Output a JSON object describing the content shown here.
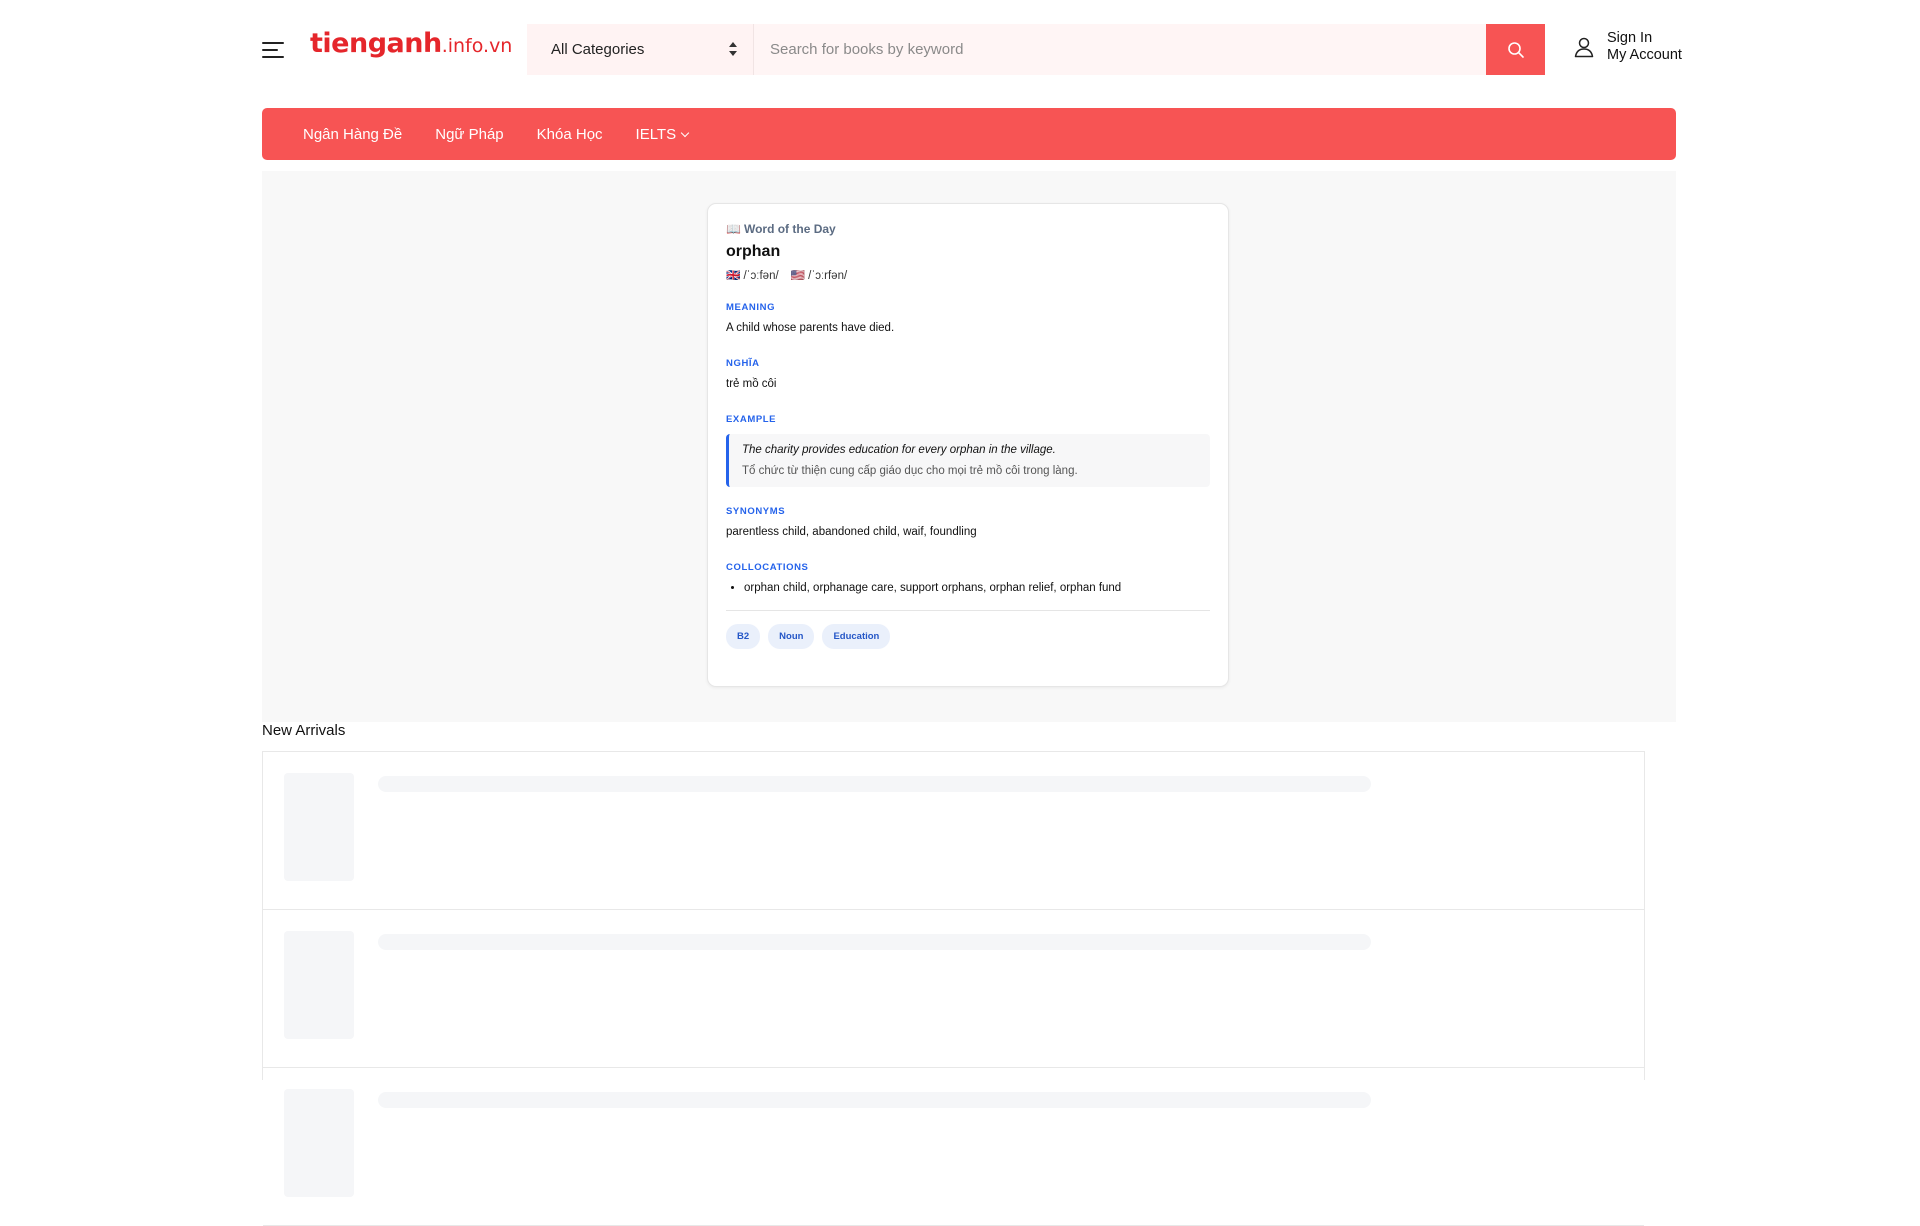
{
  "header": {
    "logo_main": "tienganh",
    "logo_suffix": ".info.vn",
    "category_selected": "All Categories",
    "search_placeholder": "Search for books by keyword",
    "account_sign_in": "Sign In",
    "account_my_account": "My Account"
  },
  "nav": {
    "items": [
      "Ngân Hàng Đề",
      "Ngữ Pháp",
      "Khóa Học",
      "IELTS"
    ]
  },
  "wotd": {
    "label": "Word of the Day",
    "book_icon": "📖",
    "word": "orphan",
    "phonetic_uk": "🇬🇧 /ˈɔːfən/",
    "phonetic_us": "🇺🇸 /ˈɔːrfən/",
    "meaning_title": "MEANING",
    "meaning": "A child whose parents have died.",
    "nghia_title": "NGHĨA",
    "nghia": "trẻ mồ côi",
    "example_title": "EXAMPLE",
    "example_en": "The charity provides education for every orphan in the village.",
    "example_vi": "Tổ chức từ thiện cung cấp giáo dục cho mọi trẻ mồ côi trong làng.",
    "synonyms_title": "SYNONYMS",
    "synonyms": "parentless child, abandoned child, waif, foundling",
    "collocations_title": "COLLOCATIONS",
    "collocations": "orphan child, orphanage care, support orphans, orphan relief, orphan fund",
    "tags": [
      "B2",
      "Noun",
      "Education"
    ]
  },
  "new_arrivals": {
    "title": "New Arrivals"
  },
  "colors": {
    "brand_red": "#f75454",
    "logo_red": "#e5262b",
    "accent_blue": "#2563eb"
  }
}
